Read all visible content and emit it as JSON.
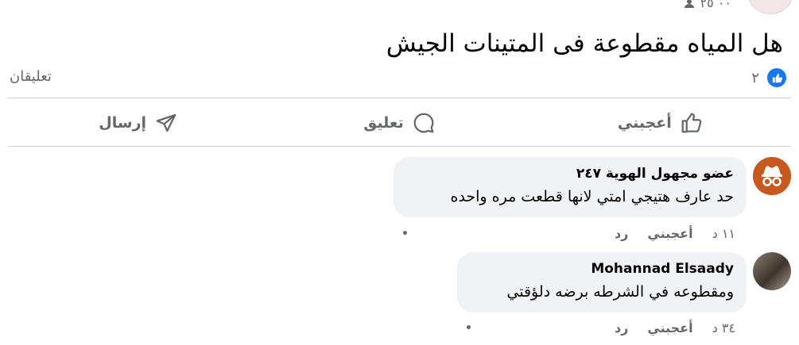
{
  "post": {
    "meta_time": "٠٠ ٢٥",
    "text": "هل المياه مقطوعة فى المتينات الجيش",
    "reaction_count": "٢",
    "comments_count": "تعليقان",
    "accent_color": "#1877f2"
  },
  "actions": {
    "like": "أعجبني",
    "comment": "تعليق",
    "send": "إرسال"
  },
  "comments": [
    {
      "author": "عضو مجهول الهوية ٢٤٧",
      "text": "حد عارف هتيجي امتي لانها قطعت مره واحده",
      "time": "١١ د",
      "like": "أعجبني",
      "reply": "رد",
      "avatar_icon": "incognito-icon"
    },
    {
      "author": "Mohannad Elsaady",
      "text": "ومقطوعه في الشرطه برضه دلؤقتي",
      "time": "٣٤ د",
      "like": "أعجبني",
      "reply": "رد",
      "avatar_icon": "profile-photo"
    }
  ]
}
